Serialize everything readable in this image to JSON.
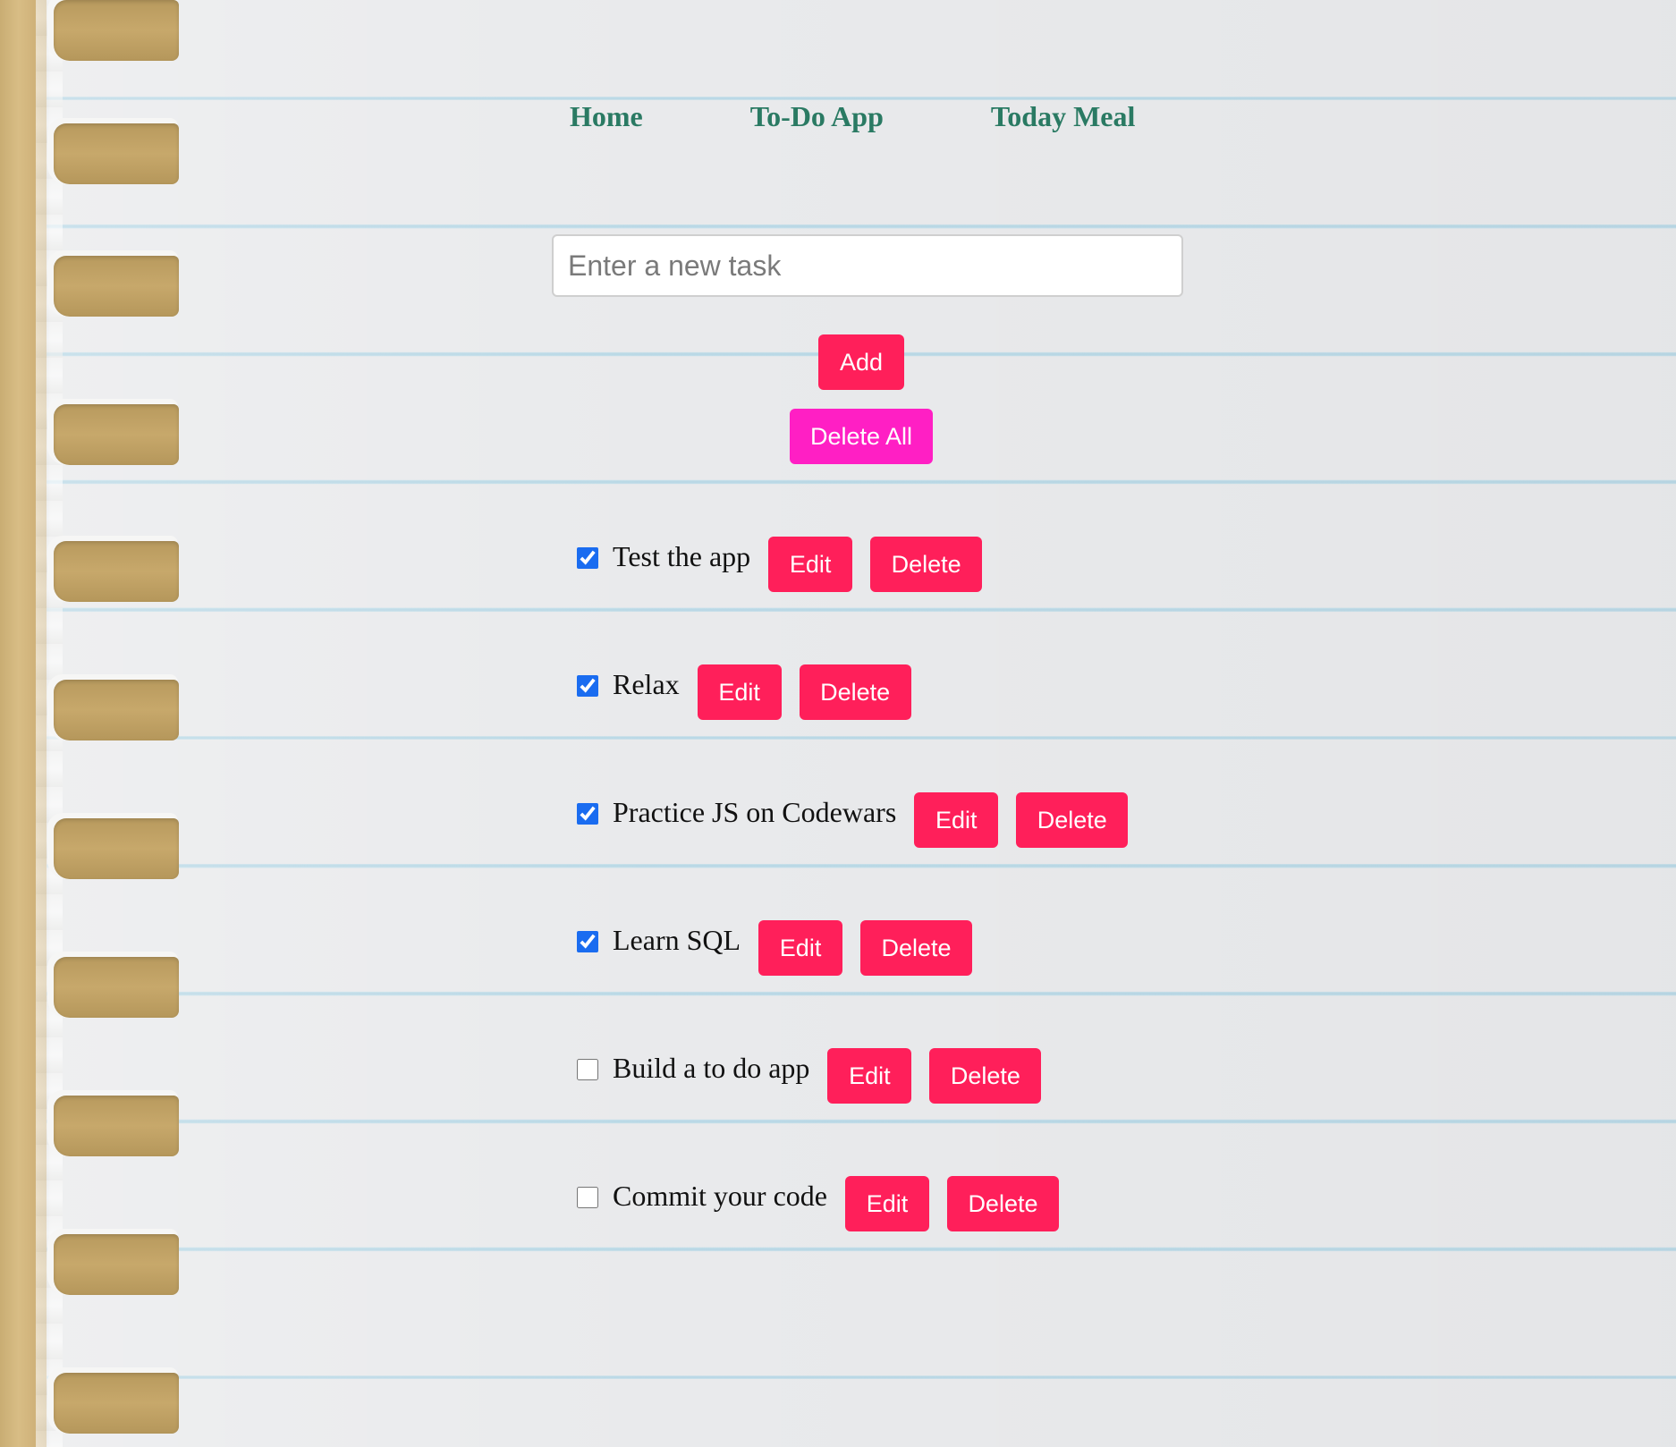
{
  "nav": {
    "home": "Home",
    "todo": "To-Do App",
    "meal": "Today Meal"
  },
  "input": {
    "placeholder": "Enter a new task",
    "value": ""
  },
  "buttons": {
    "add": "Add",
    "delete_all": "Delete All",
    "edit": "Edit",
    "delete": "Delete"
  },
  "tasks": [
    {
      "text": "Test the app",
      "checked": true
    },
    {
      "text": "Relax",
      "checked": true
    },
    {
      "text": "Practice JS on Codewars",
      "checked": true
    },
    {
      "text": "Learn SQL",
      "checked": true
    },
    {
      "text": "Build a to do app",
      "checked": false
    },
    {
      "text": "Commit your code",
      "checked": false
    }
  ],
  "colors": {
    "nav_link": "#2a7a63",
    "primary_button": "#ff1f5a",
    "delete_all_button": "#ff1fc4",
    "checkbox": "#1a6cf0"
  }
}
